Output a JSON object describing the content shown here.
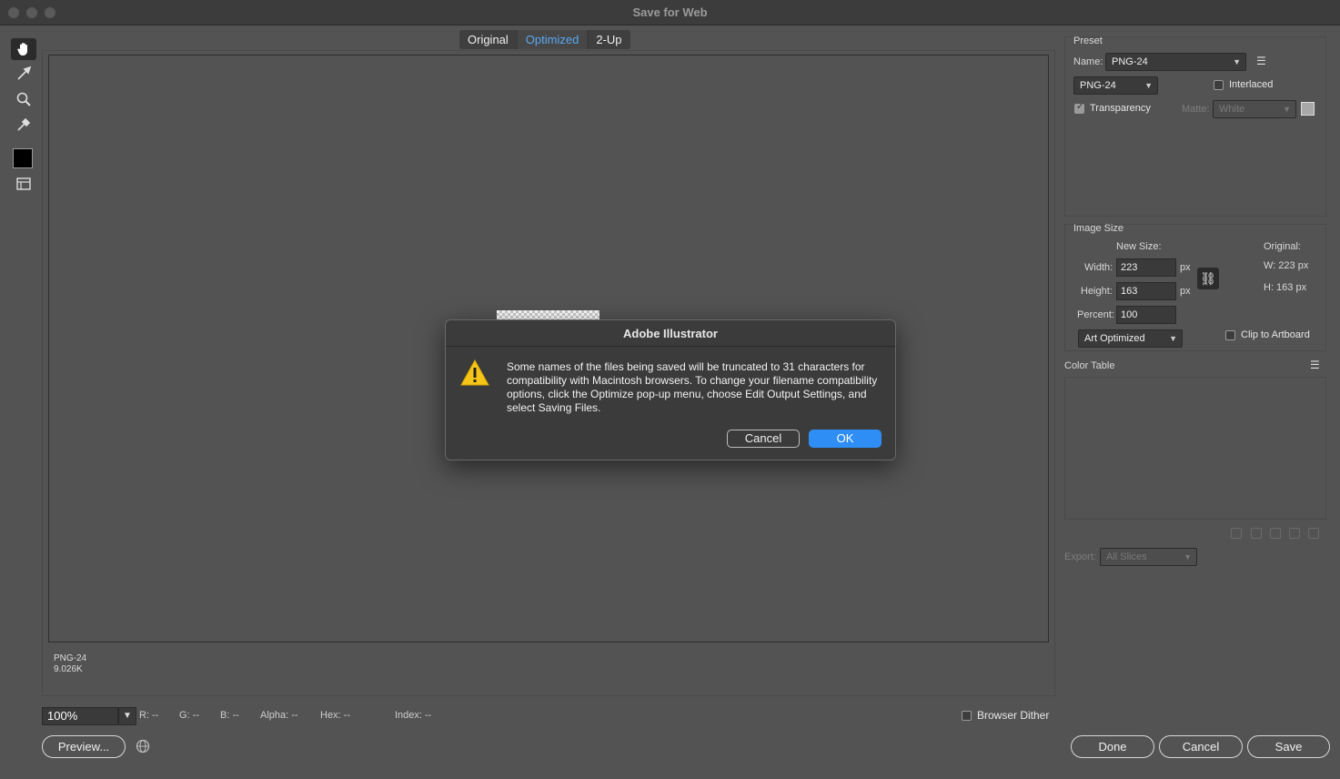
{
  "window": {
    "title": "Save for Web"
  },
  "view_tabs": [
    "Original",
    "Optimized",
    "2-Up"
  ],
  "tools": [
    {
      "name": "hand-tool-icon"
    },
    {
      "name": "slice-select-tool-icon"
    },
    {
      "name": "zoom-tool-icon"
    },
    {
      "name": "eyedropper-tool-icon"
    },
    {
      "name": "toggle-slices-icon"
    }
  ],
  "canvas": {
    "format_label": "PNG-24",
    "size_label": "9.026K"
  },
  "status": {
    "zoom": "100%",
    "r": "R: --",
    "g": "G: --",
    "b": "B: --",
    "alpha": "Alpha: --",
    "hex": "Hex: --",
    "index": "Index: --",
    "browser_dither": "Browser Dither"
  },
  "buttons": {
    "preview": "Preview...",
    "done": "Done",
    "cancel": "Cancel",
    "save": "Save"
  },
  "preset": {
    "heading": "Preset",
    "name_label": "Name:",
    "name_value": "PNG-24",
    "format_value": "PNG-24",
    "interlaced": "Interlaced",
    "transparency": "Transparency",
    "matte_label": "Matte:",
    "matte_value": "White"
  },
  "image_size": {
    "heading": "Image Size",
    "new_size": "New Size:",
    "width_label": "Width:",
    "width_value": "223",
    "height_label": "Height:",
    "height_value": "163",
    "percent_label": "Percent:",
    "percent_value": "100",
    "unit": "px",
    "original_label": "Original:",
    "orig_w": "W:  223 px",
    "orig_h": "H:  163 px",
    "quality": "Art Optimized",
    "clip": "Clip to Artboard"
  },
  "color_table": {
    "heading": "Color Table"
  },
  "export": {
    "label": "Export:",
    "value": "All Slices"
  },
  "dialog": {
    "title": "Adobe Illustrator",
    "message": "Some names of the files being saved will be truncated to 31 characters for compatibility with Macintosh browsers. To change your filename compatibility options, click the Optimize pop-up menu, choose Edit Output Settings, and select Saving Files.",
    "cancel": "Cancel",
    "ok": "OK"
  },
  "colors": {
    "accent": "#2f8ef5",
    "tab_active_text": "#5aa8f0",
    "warning": "#f5c518"
  }
}
